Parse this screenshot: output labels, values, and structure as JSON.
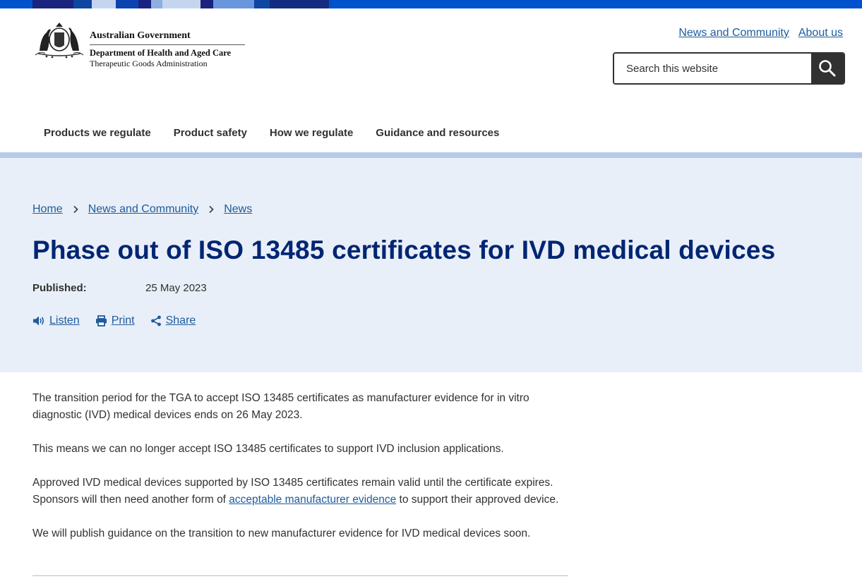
{
  "brand": {
    "government": "Australian Government",
    "department": "Department of Health and Aged Care",
    "agency": "Therapeutic Goods Administration"
  },
  "utility_links": [
    "News and Community",
    "About us"
  ],
  "search": {
    "placeholder": "Search this website",
    "icon": "search-icon"
  },
  "main_nav": [
    "Products we regulate",
    "Product safety",
    "How we regulate",
    "Guidance and resources"
  ],
  "breadcrumb": [
    "Home",
    "News and Community",
    "News"
  ],
  "page": {
    "title": "Phase out of ISO 13485 certificates for IVD medical devices",
    "published_label": "Published:",
    "published_date": "25 May 2023"
  },
  "actions": [
    {
      "label": "Listen",
      "icon": "speaker-icon"
    },
    {
      "label": "Print",
      "icon": "printer-icon"
    },
    {
      "label": "Share",
      "icon": "share-icon"
    }
  ],
  "content": {
    "p1": "The transition period for the TGA to accept ISO 13485 certificates as manufacturer evidence for in vitro diagnostic (IVD) medical devices ends on 26 May 2023.",
    "p2": "This means we can no longer accept ISO 13485 certificates to support IVD inclusion applications.",
    "p3_before": "Approved IVD medical devices supported by ISO 13485 certificates remain valid until the certificate expires. Sponsors will then need another form of ",
    "p3_link": "acceptable manufacturer evidence",
    "p3_after": " to support their approved device.",
    "p4": "We will publish guidance on the transition to new manufacturer evidence for IVD medical devices soon."
  },
  "colors": {
    "title": "#002573",
    "link": "#1d5b9c",
    "hero_bg": "#e9eff8",
    "top_strip": "#0052cc"
  }
}
